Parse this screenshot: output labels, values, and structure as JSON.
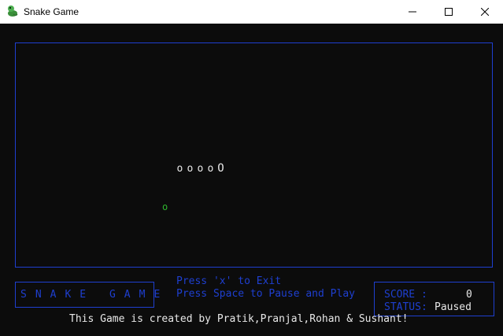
{
  "window": {
    "title": "Snake Game",
    "icon": "snake-app-icon"
  },
  "controls": {
    "minimize": "minimize-icon",
    "maximize": "maximize-icon",
    "close": "close-icon"
  },
  "game": {
    "snake_body": [
      "o",
      "o",
      "o",
      "o"
    ],
    "snake_head": "O",
    "food": "o"
  },
  "footer": {
    "title": "SNAKE GAME",
    "instruction_exit": "Press 'x' to Exit",
    "instruction_pause": "Press Space to Pause and Play",
    "score_label": "SCORE :",
    "score_value": "0",
    "status_label": "STATUS:",
    "status_value": "Paused",
    "credits": "This Game is created by Pratik,Pranjal,Rohan & Sushant!"
  },
  "colors": {
    "background": "#0c0c0c",
    "accent_blue": "#1e3fd0",
    "text": "#e8e8e8",
    "food": "#2fb52f"
  }
}
